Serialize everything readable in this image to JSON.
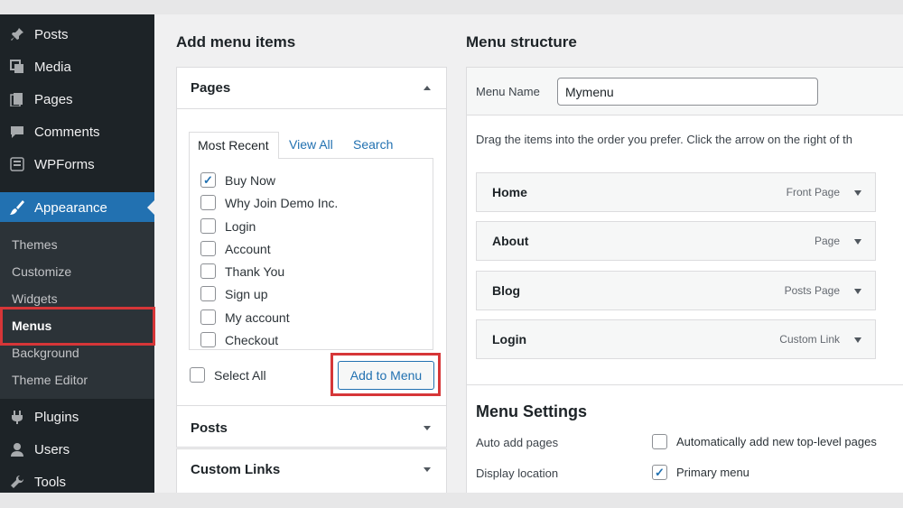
{
  "sidebar": {
    "top_items": [
      {
        "label": "Posts",
        "icon": "pin-icon"
      },
      {
        "label": "Media",
        "icon": "media-icon"
      },
      {
        "label": "Pages",
        "icon": "pages-icon"
      },
      {
        "label": "Comments",
        "icon": "comments-icon"
      },
      {
        "label": "WPForms",
        "icon": "wpforms-icon"
      }
    ],
    "active": {
      "label": "Appearance",
      "icon": "brush-icon"
    },
    "submenu": [
      "Themes",
      "Customize",
      "Widgets",
      "Menus",
      "Background",
      "Theme Editor"
    ],
    "current_submenu": "Menus",
    "bottom_items": [
      {
        "label": "Plugins",
        "icon": "plug-icon"
      },
      {
        "label": "Users",
        "icon": "user-icon"
      },
      {
        "label": "Tools",
        "icon": "wrench-icon"
      }
    ]
  },
  "add_items": {
    "heading": "Add menu items",
    "pages_box": {
      "title": "Pages",
      "tabs": [
        "Most Recent",
        "View All",
        "Search"
      ],
      "items": [
        {
          "label": "Buy Now",
          "checked": true
        },
        {
          "label": "Why Join Demo Inc.",
          "checked": false
        },
        {
          "label": "Login",
          "checked": false
        },
        {
          "label": "Account",
          "checked": false
        },
        {
          "label": "Thank You",
          "checked": false
        },
        {
          "label": "Sign up",
          "checked": false
        },
        {
          "label": "My account",
          "checked": false
        },
        {
          "label": "Checkout",
          "checked": false
        }
      ],
      "select_all": "Select All",
      "add_button": "Add to Menu"
    },
    "posts_title": "Posts",
    "custom_links_title": "Custom Links"
  },
  "structure": {
    "heading": "Menu structure",
    "menu_name_label": "Menu Name",
    "menu_name_value": "Mymenu",
    "instructions": "Drag the items into the order you prefer. Click the arrow on the right of th",
    "items": [
      {
        "title": "Home",
        "type": "Front Page"
      },
      {
        "title": "About",
        "type": "Page"
      },
      {
        "title": "Blog",
        "type": "Posts Page"
      },
      {
        "title": "Login",
        "type": "Custom Link"
      }
    ],
    "settings": {
      "title": "Menu Settings",
      "auto_add_label": "Auto add pages",
      "auto_add_option": "Automatically add new top-level pages",
      "auto_add_checked": false,
      "display_location_label": "Display location",
      "primary_option": "Primary menu",
      "primary_checked": true
    }
  },
  "colors": {
    "accent": "#2271b1",
    "sidebar_bg": "#1d2327",
    "highlight": "#d63638"
  }
}
